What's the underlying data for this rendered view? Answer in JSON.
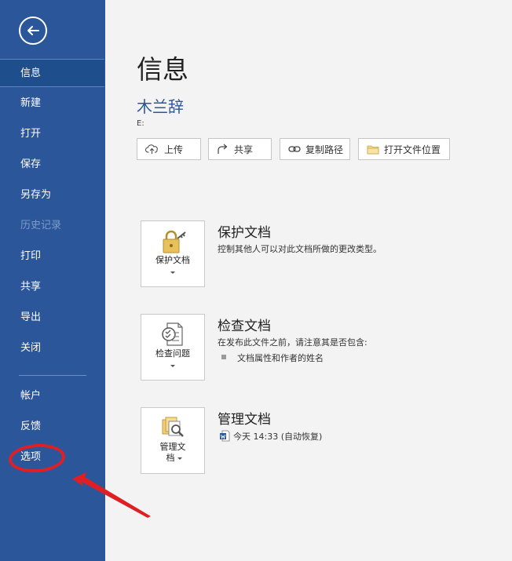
{
  "sidebar": {
    "items": [
      {
        "label": "信息"
      },
      {
        "label": "新建"
      },
      {
        "label": "打开"
      },
      {
        "label": "保存"
      },
      {
        "label": "另存为"
      },
      {
        "label": "历史记录"
      },
      {
        "label": "打印"
      },
      {
        "label": "共享"
      },
      {
        "label": "导出"
      },
      {
        "label": "关闭"
      },
      {
        "label": "帐户"
      },
      {
        "label": "反馈"
      },
      {
        "label": "选项"
      }
    ],
    "selected": "信息",
    "disabled": [
      "历史记录"
    ]
  },
  "info": {
    "title": "信息",
    "doc_name": "木兰辞",
    "doc_path": "E:"
  },
  "actions": [
    {
      "label": "上传",
      "icon": "upload-cloud-icon"
    },
    {
      "label": "共享",
      "icon": "share-icon"
    },
    {
      "label": "复制路径",
      "icon": "link-icon"
    },
    {
      "label": "打开文件位置",
      "icon": "folder-icon"
    }
  ],
  "sections": {
    "protect": {
      "button_label": "保护文档",
      "title": "保护文档",
      "description": "控制其他人可以对此文档所做的更改类型。"
    },
    "inspect": {
      "button_label": "检查问题",
      "title": "检查文档",
      "description": "在发布此文件之前，请注意其是否包含:",
      "bullets": [
        "文档属性和作者的姓名"
      ]
    },
    "manage": {
      "button_label_line1": "管理文",
      "button_label_line2": "档",
      "title": "管理文档",
      "version_entry": "今天 14:33 (自动恢复)"
    }
  },
  "colors": {
    "sidebar_bg": "#2b579a",
    "accent": "#2b579a",
    "annotation_red": "#e01f25"
  }
}
